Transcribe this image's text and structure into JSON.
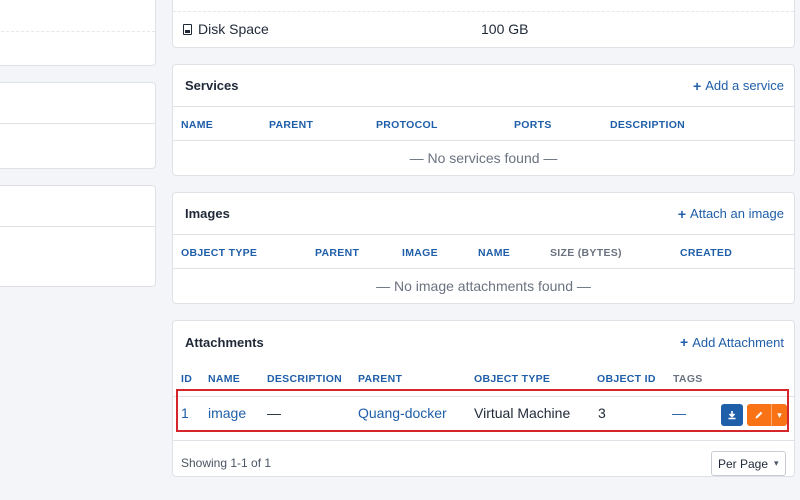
{
  "disk": {
    "label": "Disk Space",
    "value": "100 GB"
  },
  "services": {
    "title": "Services",
    "add_label": "Add a service",
    "columns": [
      "NAME",
      "PARENT",
      "PROTOCOL",
      "PORTS",
      "DESCRIPTION"
    ],
    "empty": "— No services found —"
  },
  "images": {
    "title": "Images",
    "add_label": "Attach an image",
    "columns": [
      "OBJECT TYPE",
      "PARENT",
      "IMAGE",
      "NAME",
      "SIZE (BYTES)",
      "CREATED"
    ],
    "empty": "— No image attachments found —"
  },
  "attachments": {
    "title": "Attachments",
    "add_label": "Add Attachment",
    "columns": [
      "ID",
      "NAME",
      "DESCRIPTION",
      "PARENT",
      "OBJECT TYPE",
      "OBJECT ID",
      "TAGS"
    ],
    "rows": [
      {
        "id": "1",
        "name": "image",
        "description": "—",
        "parent": "Quang-docker",
        "object_type": "Virtual Machine",
        "object_id": "3",
        "tags": "—"
      }
    ],
    "showing": "Showing 1-1 of 1",
    "per_page": "Per Page"
  },
  "icons": {
    "plus": "plus-icon",
    "disk": "hdd-icon",
    "download": "download-icon",
    "edit": "pencil-icon",
    "caret": "chevron-down-icon"
  },
  "colors": {
    "link": "#1f5ea8",
    "edit_button": "#f97316",
    "highlight": "#d7262b"
  }
}
